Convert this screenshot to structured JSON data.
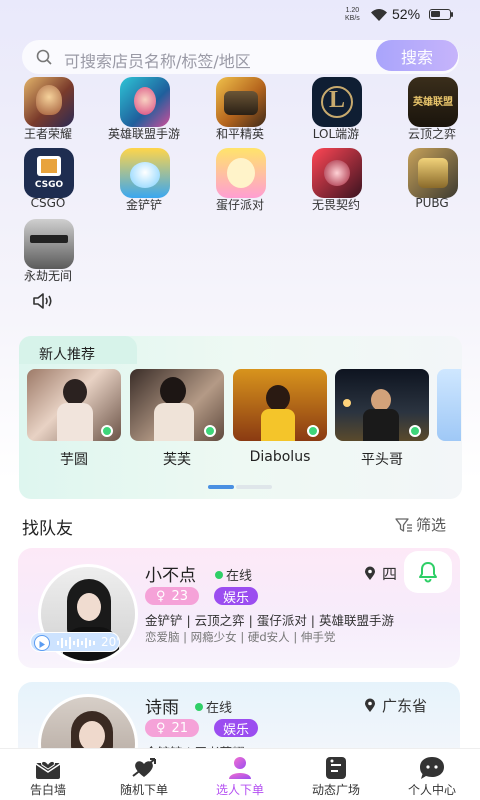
{
  "status_bar": {
    "speed_value": "1.20",
    "speed_unit": "KB/s",
    "battery": "52%",
    "battery_level": 0.52
  },
  "search": {
    "placeholder": "可搜索店员名称/标签/地区",
    "button": "搜索",
    "icon": "search-icon"
  },
  "games": [
    {
      "label": "王者荣耀"
    },
    {
      "label": "英雄联盟手游"
    },
    {
      "label": "和平精英"
    },
    {
      "label": "LOL端游"
    },
    {
      "label": "云顶之弈"
    },
    {
      "label": "CSGO"
    },
    {
      "label": "金铲铲"
    },
    {
      "label": "蛋仔派对"
    },
    {
      "label": "无畏契约"
    },
    {
      "label": "PUBG"
    },
    {
      "label": "永劫无间"
    }
  ],
  "game_logo_text": {
    "lol": "L",
    "yunding": "英雄联盟",
    "csgo": "CSGO"
  },
  "new_people": {
    "title": "新人推荐",
    "items": [
      {
        "name": "芋圆"
      },
      {
        "name": "芙芙"
      },
      {
        "name": "Diabolus"
      },
      {
        "name": "平头哥"
      }
    ]
  },
  "team": {
    "title": "找队友",
    "filter": "筛选"
  },
  "cards": [
    {
      "name": "小不点",
      "status": "在线",
      "location": "四",
      "age": "23",
      "category": "娱乐",
      "games": "金铲铲 | 云顶之弈 | 蛋仔派对 | 英雄联盟手游",
      "tags": "恋爱脑 | 网瘾少女 | 硬d安人 | 伸手党",
      "voice_seconds": "20'"
    },
    {
      "name": "诗雨",
      "status": "在线",
      "location": "广东省",
      "age": "21",
      "category": "娱乐",
      "games": "金铲铲 | 王者荣耀"
    }
  ],
  "nav": [
    {
      "label": "告白墙",
      "icon": "love-letter-icon"
    },
    {
      "label": "随机下单",
      "icon": "heart-arrow-icon"
    },
    {
      "label": "选人下单",
      "icon": "person-select-icon",
      "active": true
    },
    {
      "label": "动态广场",
      "icon": "feed-icon"
    },
    {
      "label": "个人中心",
      "icon": "profile-chat-icon"
    }
  ],
  "colors": {
    "accent": "#b44ff2",
    "online": "#2fcf67",
    "search_button": "#b3acfb",
    "age_badge": "#f5a2d8",
    "category_badge": "#9b4df0"
  }
}
